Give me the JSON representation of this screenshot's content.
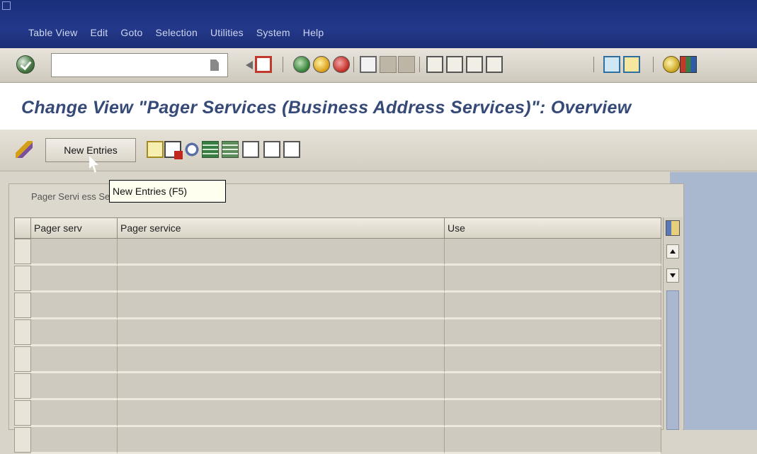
{
  "menu": {
    "items": [
      "Table View",
      "Edit",
      "Goto",
      "Selection",
      "Utilities",
      "System",
      "Help"
    ]
  },
  "toolbar": {
    "command_field_value": "",
    "icons": [
      "ok-icon",
      "back-icon",
      "save-icon",
      "green-back-icon",
      "exit-icon",
      "cancel-icon",
      "print-icon",
      "find-icon",
      "find-next-icon",
      "first-page-icon",
      "previous-page-icon",
      "next-page-icon",
      "last-page-icon",
      "create-session-icon",
      "shortcut-icon",
      "help-icon",
      "layout-icon"
    ]
  },
  "page": {
    "title": "Change View \"Pager Services (Business Address Services)\": Overview"
  },
  "app_toolbar": {
    "new_entries_label": "New Entries"
  },
  "tooltip": {
    "text": "New Entries   (F5)"
  },
  "table": {
    "caption": "Pager Servi              ess Services)",
    "columns": [
      "Pager serv",
      "Pager service",
      "Use"
    ],
    "row_count": 8
  },
  "colors": {
    "menu_bar": "#23388a",
    "title_text": "#364a78",
    "panel_bg": "#d9d4c9",
    "right_panel": "#aab8cf"
  }
}
